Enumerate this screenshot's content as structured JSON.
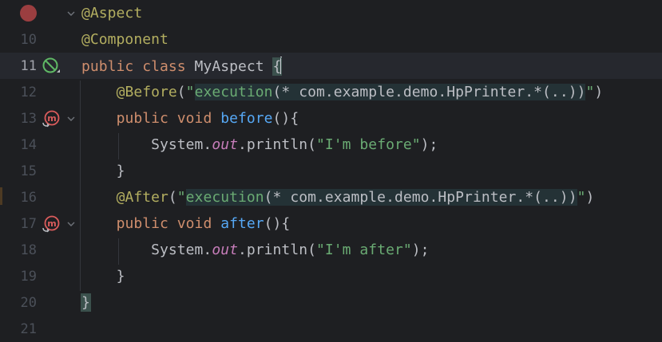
{
  "editor": {
    "lines": [
      {
        "num": "",
        "tokens": [
          {
            "t": "@Aspect",
            "c": "ann"
          }
        ]
      },
      {
        "num": "10",
        "tokens": [
          {
            "t": "@Component",
            "c": "ann"
          }
        ]
      },
      {
        "num": "11",
        "tokens": [
          {
            "t": "public ",
            "c": "kw"
          },
          {
            "t": "class ",
            "c": "kw"
          },
          {
            "t": "MyAspect ",
            "c": "plain"
          },
          {
            "t": "{",
            "c": "plain brace-hl"
          }
        ]
      },
      {
        "num": "12",
        "tokens": [
          {
            "t": "    ",
            "c": "plain"
          },
          {
            "t": "@Before",
            "c": "ann"
          },
          {
            "t": "(",
            "c": "plain"
          },
          {
            "t": "\"",
            "c": "str"
          },
          {
            "t": "execution",
            "c": "str inj"
          },
          {
            "t": "(* com.example.demo.HpPrinter.*(..))",
            "c": "plain inj"
          },
          {
            "t": "\"",
            "c": "str"
          },
          {
            "t": ")",
            "c": "plain"
          }
        ]
      },
      {
        "num": "13",
        "tokens": [
          {
            "t": "    ",
            "c": "plain"
          },
          {
            "t": "public ",
            "c": "kw"
          },
          {
            "t": "void ",
            "c": "kw"
          },
          {
            "t": "before",
            "c": "fn"
          },
          {
            "t": "(){",
            "c": "plain"
          }
        ]
      },
      {
        "num": "14",
        "tokens": [
          {
            "t": "        ",
            "c": "plain"
          },
          {
            "t": "System.",
            "c": "plain"
          },
          {
            "t": "out",
            "c": "field"
          },
          {
            "t": ".println(",
            "c": "plain"
          },
          {
            "t": "\"I'm before\"",
            "c": "str"
          },
          {
            "t": ");",
            "c": "plain"
          }
        ]
      },
      {
        "num": "15",
        "tokens": [
          {
            "t": "    ",
            "c": "plain"
          },
          {
            "t": "}",
            "c": "plain"
          }
        ]
      },
      {
        "num": "16",
        "tokens": [
          {
            "t": "    ",
            "c": "plain"
          },
          {
            "t": "@After",
            "c": "ann"
          },
          {
            "t": "(",
            "c": "plain"
          },
          {
            "t": "\"",
            "c": "str"
          },
          {
            "t": "execution",
            "c": "str inj"
          },
          {
            "t": "(* com.example.demo.HpPrinter.*(..))",
            "c": "plain inj"
          },
          {
            "t": "\"",
            "c": "str"
          },
          {
            "t": ")",
            "c": "plain"
          }
        ]
      },
      {
        "num": "17",
        "tokens": [
          {
            "t": "    ",
            "c": "plain"
          },
          {
            "t": "public ",
            "c": "kw"
          },
          {
            "t": "void ",
            "c": "kw"
          },
          {
            "t": "after",
            "c": "fn"
          },
          {
            "t": "(){",
            "c": "plain"
          }
        ]
      },
      {
        "num": "18",
        "tokens": [
          {
            "t": "        ",
            "c": "plain"
          },
          {
            "t": "System.",
            "c": "plain"
          },
          {
            "t": "out",
            "c": "field"
          },
          {
            "t": ".println(",
            "c": "plain"
          },
          {
            "t": "\"I'm after\"",
            "c": "str"
          },
          {
            "t": ");",
            "c": "plain"
          }
        ]
      },
      {
        "num": "19",
        "tokens": [
          {
            "t": "    ",
            "c": "plain"
          },
          {
            "t": "}",
            "c": "plain"
          }
        ]
      },
      {
        "num": "20",
        "tokens": [
          {
            "t": "}",
            "c": "plain brace-hl"
          }
        ]
      },
      {
        "num": "21",
        "tokens": []
      }
    ],
    "current_line_index": 2,
    "colors": {
      "background": "#1e1f22",
      "keyword": "#cf8e6d",
      "annotation": "#b3ae60",
      "string": "#6aab73",
      "method": "#56a8f5",
      "field": "#c77dba",
      "breakpoint": "#9b3e40",
      "gutter_icon_green": "#5fb865",
      "gutter_icon_red": "#db5c5c"
    },
    "gutter_icons": [
      {
        "line_index": 0,
        "icon": "breakpoint-icon"
      },
      {
        "line_index": 2,
        "icon": "aspect-no-usages-icon"
      },
      {
        "line_index": 4,
        "icon": "advice-method-icon",
        "letter": "m"
      },
      {
        "line_index": 8,
        "icon": "advice-method-icon",
        "letter": "m"
      }
    ],
    "fold_lines": [
      0,
      4,
      8
    ]
  }
}
